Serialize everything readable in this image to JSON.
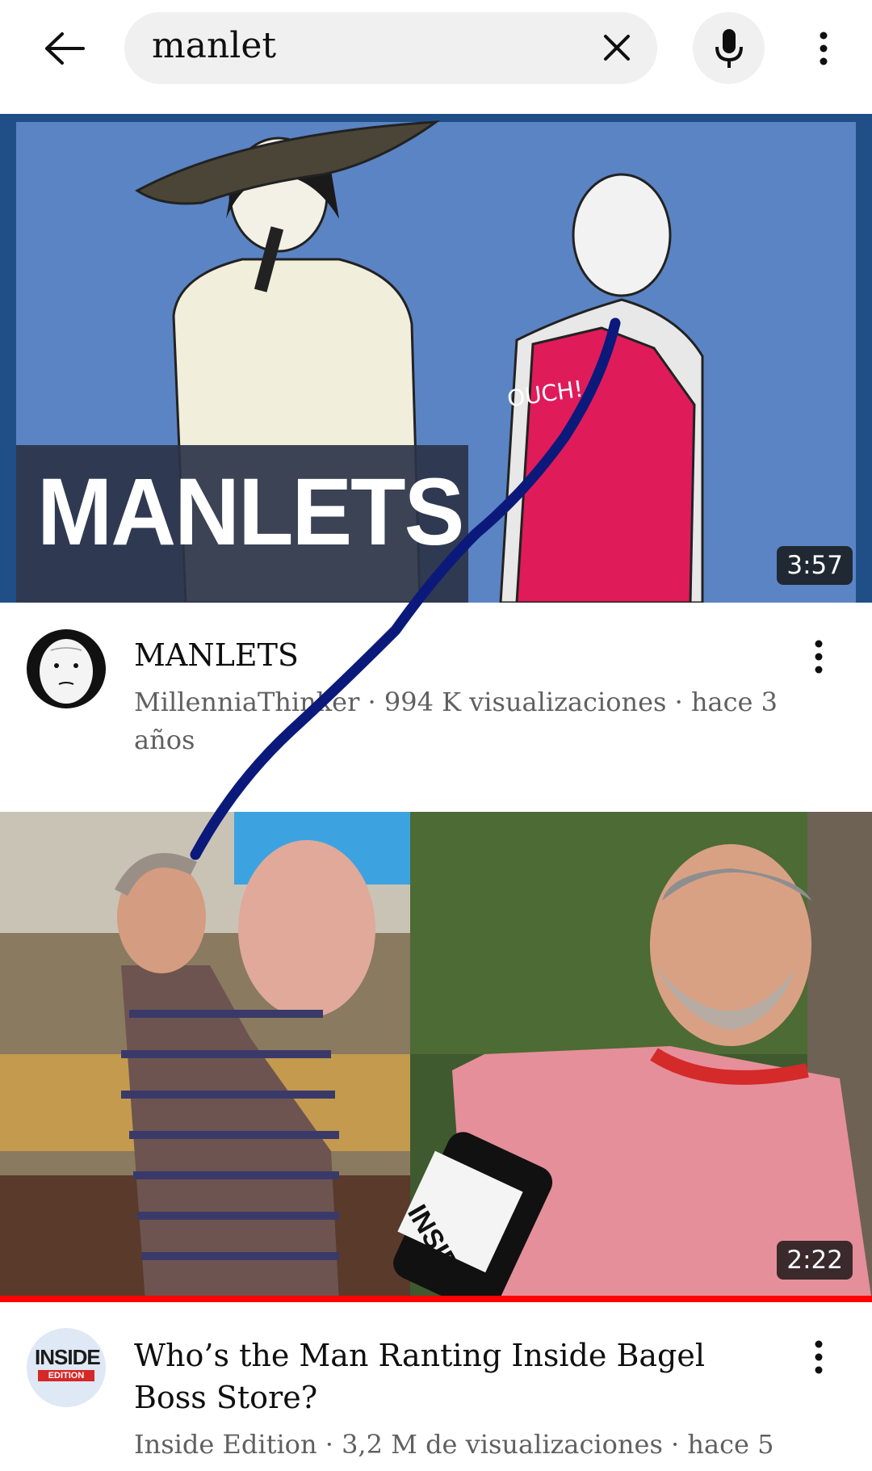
{
  "search": {
    "query": "manlet"
  },
  "videos": [
    {
      "thumbnail_text": "MANLETS",
      "thumbnail_bubble": "OUCH!",
      "duration": "3:57",
      "title": "MANLETS",
      "channel": "MillenniaThinker",
      "stats": "MillenniaThinker · 994 K visualizaciones · hace 3 años",
      "progress": 0
    },
    {
      "thumbnail_logo": "INSIDE",
      "duration": "2:22",
      "title": "Who’s the Man Ranting Inside Bagel Boss Store?",
      "channel": "Inside Edition",
      "avatar_logo_top": "INSIDE",
      "avatar_logo_bottom": "EDITION",
      "stats": "Inside Edition · 3,2 M de visualizaciones · hace 5",
      "progress": 1.0
    }
  ],
  "colors": {
    "accent": "#ff0000",
    "overlay_stroke": "#0b1a7a"
  }
}
